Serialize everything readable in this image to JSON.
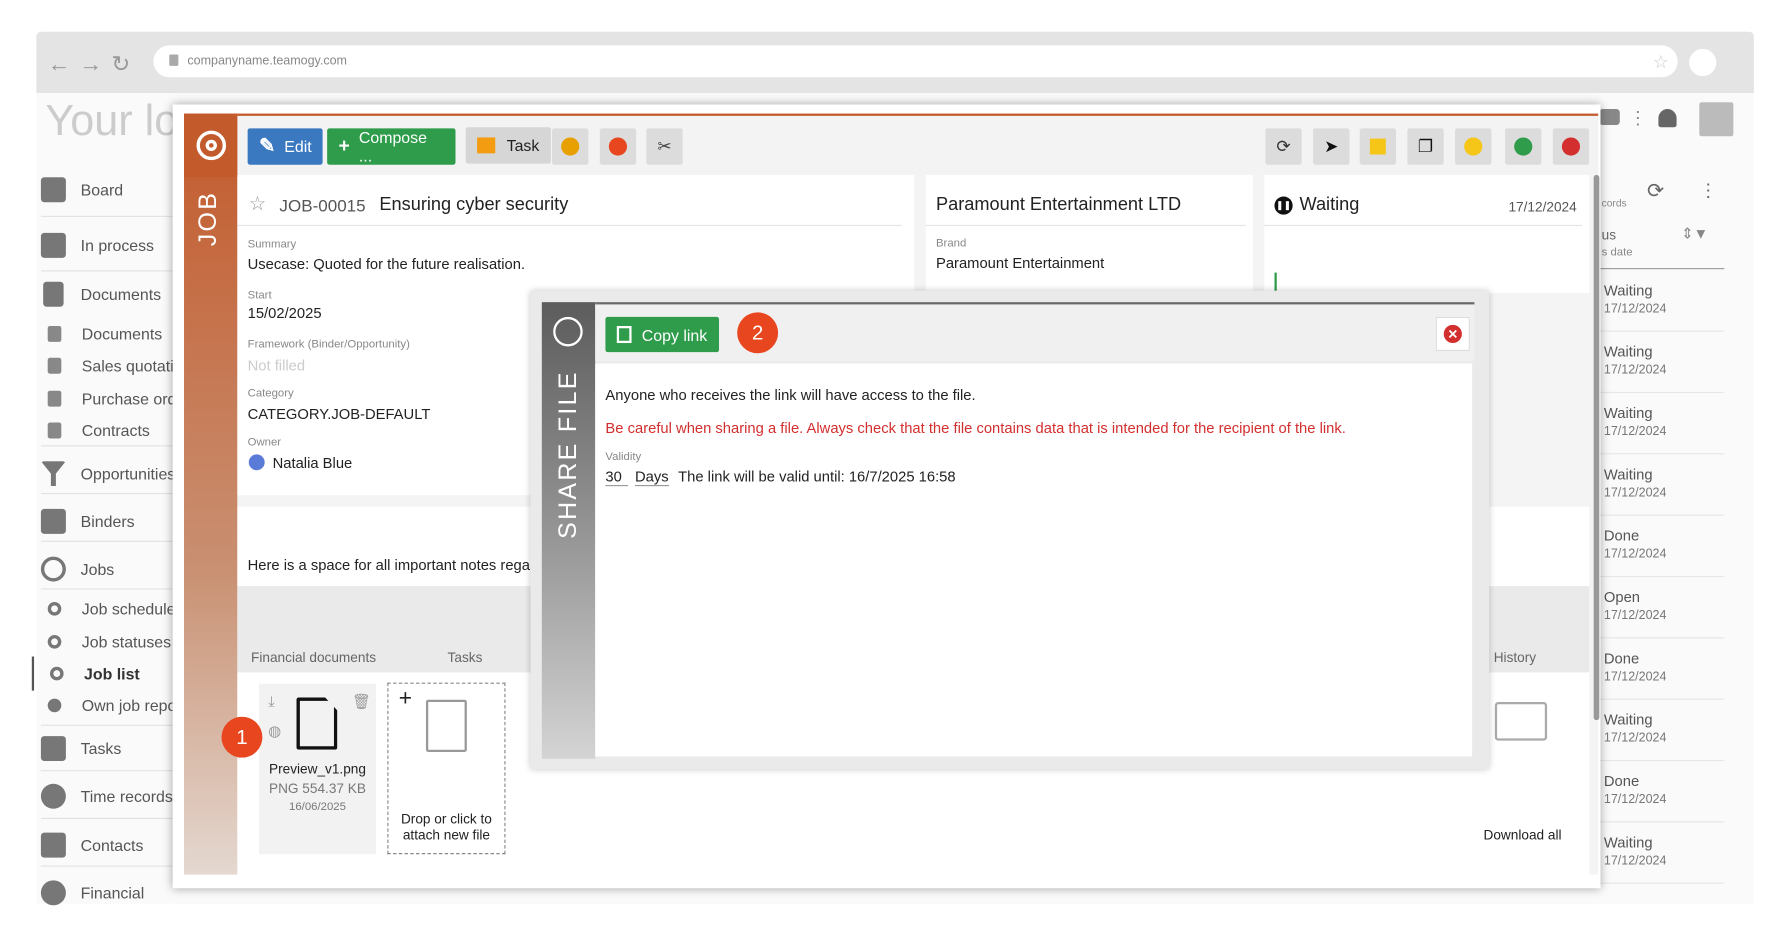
{
  "browser": {
    "url": "companyname.teamogy.com"
  },
  "background": {
    "logo": "Your log",
    "sidebar": [
      {
        "label": "Board",
        "icon": "board-icon"
      },
      {
        "label": "In process",
        "icon": "process-icon"
      },
      {
        "label": "Documents",
        "icon": "document-icon"
      },
      {
        "label": "Documents",
        "icon": "document-icon"
      },
      {
        "label": "Sales quotatio",
        "icon": "document-icon"
      },
      {
        "label": "Purchase orde",
        "icon": "document-icon"
      },
      {
        "label": "Contracts",
        "icon": "document-icon"
      },
      {
        "label": "Opportunities",
        "icon": "funnel-icon"
      },
      {
        "label": "Binders",
        "icon": "briefcase-icon"
      },
      {
        "label": "Jobs",
        "icon": "target-icon"
      },
      {
        "label": "Job schedule",
        "icon": "target-icon"
      },
      {
        "label": "Job statuses",
        "icon": "target-icon"
      },
      {
        "label": "Job list",
        "icon": "target-icon"
      },
      {
        "label": "Own job repor",
        "icon": "dollar-icon"
      },
      {
        "label": "Tasks",
        "icon": "tasks-icon"
      },
      {
        "label": "Time records",
        "icon": "clock-icon"
      },
      {
        "label": "Contacts",
        "icon": "contacts-icon"
      },
      {
        "label": "Financial",
        "icon": "dollar-icon"
      }
    ],
    "right_header": {
      "line1": "cords",
      "line2": "us",
      "line3": "s date"
    },
    "right_rows": [
      {
        "status": "Waiting",
        "date": "17/12/2024"
      },
      {
        "status": "Waiting",
        "date": "17/12/2024"
      },
      {
        "status": "Waiting",
        "date": "17/12/2024"
      },
      {
        "status": "Waiting",
        "date": "17/12/2024"
      },
      {
        "status": "Done",
        "date": "17/12/2024"
      },
      {
        "status": "Open",
        "date": "17/12/2024"
      },
      {
        "status": "Done",
        "date": "17/12/2024"
      },
      {
        "status": "Waiting",
        "date": "17/12/2024"
      },
      {
        "status": "Done",
        "date": "17/12/2024"
      },
      {
        "status": "Waiting",
        "date": "17/12/2024"
      }
    ]
  },
  "job": {
    "sidebar_label": "JOB",
    "toolbar": {
      "edit": "Edit",
      "compose": "Compose ...",
      "task": "Task"
    },
    "number": "JOB-00015",
    "title": "Ensuring cyber security",
    "summary_label": "Summary",
    "summary": "Usecase: Quoted for the future realisation.",
    "start_label": "Start",
    "start": "15/02/2025",
    "framework_label": "Framework (Binder/Opportunity)",
    "framework": "Not filled",
    "category_label": "Category",
    "category": "CATEGORY.JOB-DEFAULT",
    "owner_label": "Owner",
    "owner": "Natalia Blue",
    "client": "Paramount Entertainment LTD",
    "brand_label": "Brand",
    "brand": "Paramount Entertainment",
    "status": "Waiting",
    "status_date": "17/12/2024",
    "notes": "Here is a space for all important notes rega",
    "tabs": {
      "financial": "Financial documents",
      "tasks": "Tasks",
      "history": "History"
    },
    "file": {
      "name": "Preview_v1.png",
      "meta": "PNG 554.37 KB",
      "date": "16/06/2025"
    },
    "dropzone": {
      "plus": "+",
      "text": "Drop or click to attach new file"
    },
    "download_all": "Download all"
  },
  "share": {
    "sidebar_label": "SHARE FILE",
    "copy_link": "Copy link",
    "badge1": "1",
    "badge2": "2",
    "info": "Anyone who receives the link will have access to the file.",
    "warning": "Be careful when sharing a file. Always check that the file contains data that is intended for the recipient of the link.",
    "validity_label": "Validity",
    "validity_value": "30",
    "validity_unit": "Days",
    "valid_until": "The link will be valid until: 16/7/2025 16:58"
  },
  "colors": {
    "accent": "#c35a2c",
    "green": "#2e9c4a",
    "blue": "#3a78c0",
    "orange": "#e8461e",
    "warning": "#d32f2f"
  }
}
